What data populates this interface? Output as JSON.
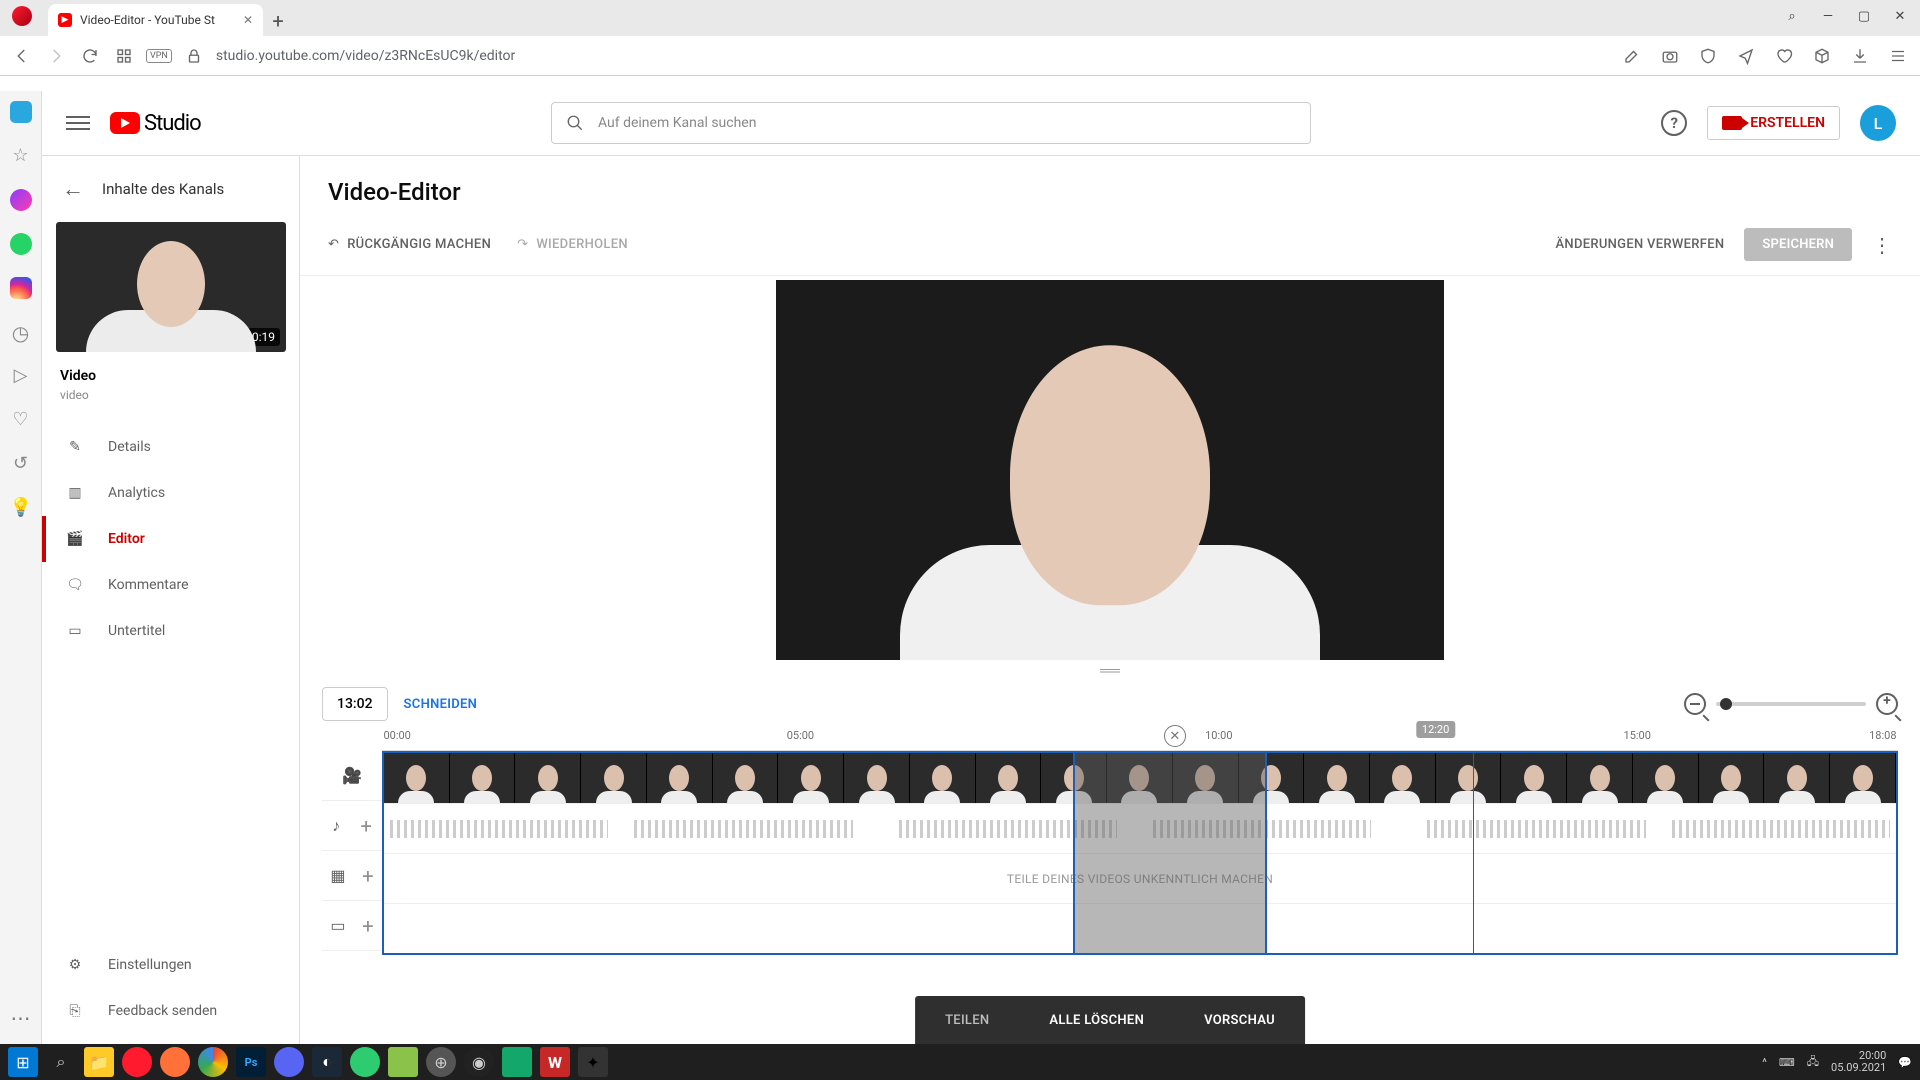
{
  "browser": {
    "tab_title": "Video-Editor - YouTube St",
    "url": "studio.youtube.com/video/z3RNcEsUC9k/editor",
    "vpn_label": "VPN"
  },
  "window_controls": {
    "search": "⌕",
    "min": "—",
    "max": "▢",
    "close": "✕"
  },
  "header": {
    "studio_label": "Studio",
    "search_placeholder": "Auf deinem Kanal suchen",
    "create_label": "ERSTELLEN",
    "avatar_initial": "L"
  },
  "sidebar": {
    "back_label": "Inhalte des Kanals",
    "thumb_duration": "0:19",
    "video_heading": "Video",
    "video_sub": "video",
    "items": [
      {
        "label": "Details"
      },
      {
        "label": "Analytics"
      },
      {
        "label": "Editor"
      },
      {
        "label": "Kommentare"
      },
      {
        "label": "Untertitel"
      }
    ],
    "bottom": [
      {
        "label": "Einstellungen"
      },
      {
        "label": "Feedback senden"
      }
    ]
  },
  "editor": {
    "title": "Video-Editor",
    "undo": "RÜCKGÄNGIG MACHEN",
    "redo": "WIEDERHOLEN",
    "discard": "ÄNDERUNGEN VERWERFEN",
    "save": "SPEICHERN",
    "current_time": "13:02",
    "cut_label": "SCHNEIDEN",
    "drag_handle": "══"
  },
  "timeline": {
    "ticks": [
      "00:00",
      "05:00",
      "10:00",
      "15:00",
      "18:08"
    ],
    "tick_pct": [
      1,
      27.6,
      55.2,
      82.8,
      99
    ],
    "close_marker_pct": 52.3,
    "tooltip_value": "12:20",
    "tooltip_pct": 69.5,
    "playhead_pct": 72,
    "cut_start_pct": 45.6,
    "cut_end_pct": 58.4,
    "blur_hint": "TEILE DEINES VIDEOS UNKENNTLICH MACHEN",
    "frame_count": 23
  },
  "actionbar": {
    "split": "TEILEN",
    "delete_all": "ALLE LÖSCHEN",
    "preview": "VORSCHAU"
  },
  "taskbar": {
    "time": "20:00",
    "date": "05.09.2021"
  }
}
